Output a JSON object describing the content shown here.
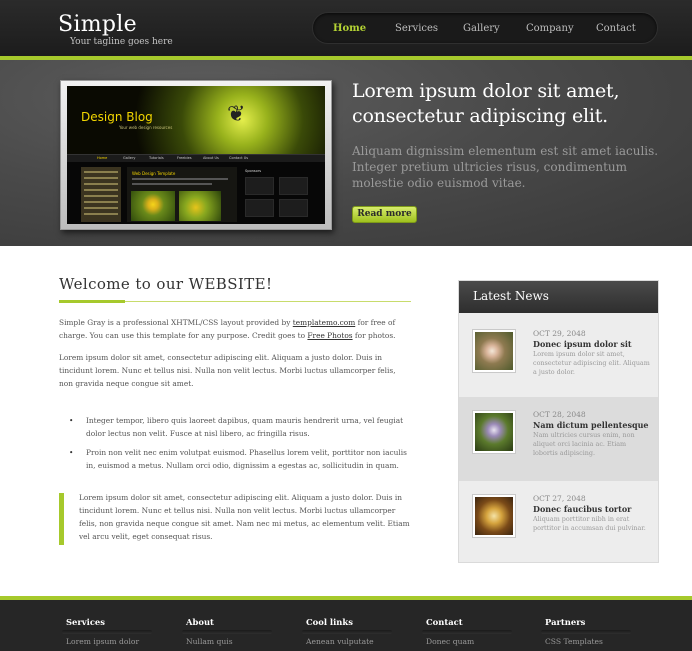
{
  "header": {
    "logo_title": "Simple",
    "tagline": "Your tagline goes here",
    "nav": [
      {
        "label": "Home",
        "active": true
      },
      {
        "label": "Services",
        "active": false
      },
      {
        "label": "Gallery",
        "active": false
      },
      {
        "label": "Company",
        "active": false
      },
      {
        "label": "Contact",
        "active": false
      }
    ]
  },
  "banner": {
    "preview": {
      "title": "Design Blog",
      "subtitle": "Your web design resources",
      "nav": [
        "Home",
        "Gallery",
        "Tutorials",
        "Freebies",
        "About Us",
        "Contact Us"
      ],
      "post_title": "Web Design Template",
      "sidebar_title": "Sponsors"
    },
    "heading": "Lorem ipsum dolor sit amet, consectetur adipiscing elit.",
    "text": "Aliquam dignissim elementum est sit amet iaculis. Integer pretium ultricies risus, condimentum molestie odio euismod vitae.",
    "button": "Read more"
  },
  "main": {
    "heading": "Welcome to our WEBSITE!",
    "intro": {
      "part1": "Simple Gray is a professional XHTML/CSS layout provided by ",
      "link1": "templatemo.com",
      "part2": " for free of charge. You can use this template for any purpose. Credit goes to ",
      "link2": "Free Photos",
      "part3": " for photos."
    },
    "paragraph": "Lorem ipsum dolor sit amet, consectetur adipiscing elit. Aliquam a justo dolor. Duis in tincidunt lorem. Nunc et tellus nisi. Nulla non velit lectus. Morbi luctus ullamcorper felis, non gravida neque congue sit amet.",
    "bullets": [
      "Integer tempor, libero quis laoreet dapibus, quam mauris hendrerit urna, vel feugiat dolor lectus non velit. Fusce at nisl libero, ac fringilla risus.",
      "Proin non velit nec enim volutpat euismod. Phasellus lorem velit, porttitor non iaculis in, euismod a metus. Nullam orci odio, dignissim a egestas ac, sollicitudin in quam."
    ],
    "quote": "Lorem ipsum dolor sit amet, consectetur adipiscing elit. Aliquam a justo dolor. Duis in tincidunt lorem. Nunc et tellus nisi. Nulla non velit lectus. Morbi luctus ullamcorper felis, non gravida neque congue sit amet. Nam nec mi metus, ac elementum velit. Etiam vel arcu velit, eget consequat risus."
  },
  "sidebar": {
    "title": "Latest News",
    "items": [
      {
        "date": "OCT 29, 2048",
        "title": "Donec ipsum dolor sit",
        "text": "Lorem ipsum dolor sit amet, consectetur adipiscing elit. Aliquam a justo dolor.",
        "thumb_icon": "flower-photo-icon"
      },
      {
        "date": "OCT 28, 2048",
        "title": "Nam dictum pellentesque",
        "text": "Nam ultricies cursus enim, non aliquet orci lacinia ac. Etiam lobortis adipiscing.",
        "thumb_icon": "insect-photo-icon"
      },
      {
        "date": "OCT 27, 2048",
        "title": "Donec faucibus tortor",
        "text": "Aliquam porttitor nibh in erat porttitor in accumsan dui pulvinar.",
        "thumb_icon": "teacup-photo-icon"
      }
    ]
  },
  "footer": {
    "columns": [
      {
        "title": "Services",
        "link": "Lorem ipsum dolor"
      },
      {
        "title": "About",
        "link": "Nullam quis"
      },
      {
        "title": "Cool links",
        "link": "Aenean vulputate"
      },
      {
        "title": "Contact",
        "link": "Donec quam"
      },
      {
        "title": "Partners",
        "link": "CSS Templates"
      }
    ]
  },
  "colors": {
    "accent": "#a6c92c",
    "header_bg": "#222222",
    "banner_bg": "#4a4a4a",
    "footer_bg": "#262626"
  }
}
